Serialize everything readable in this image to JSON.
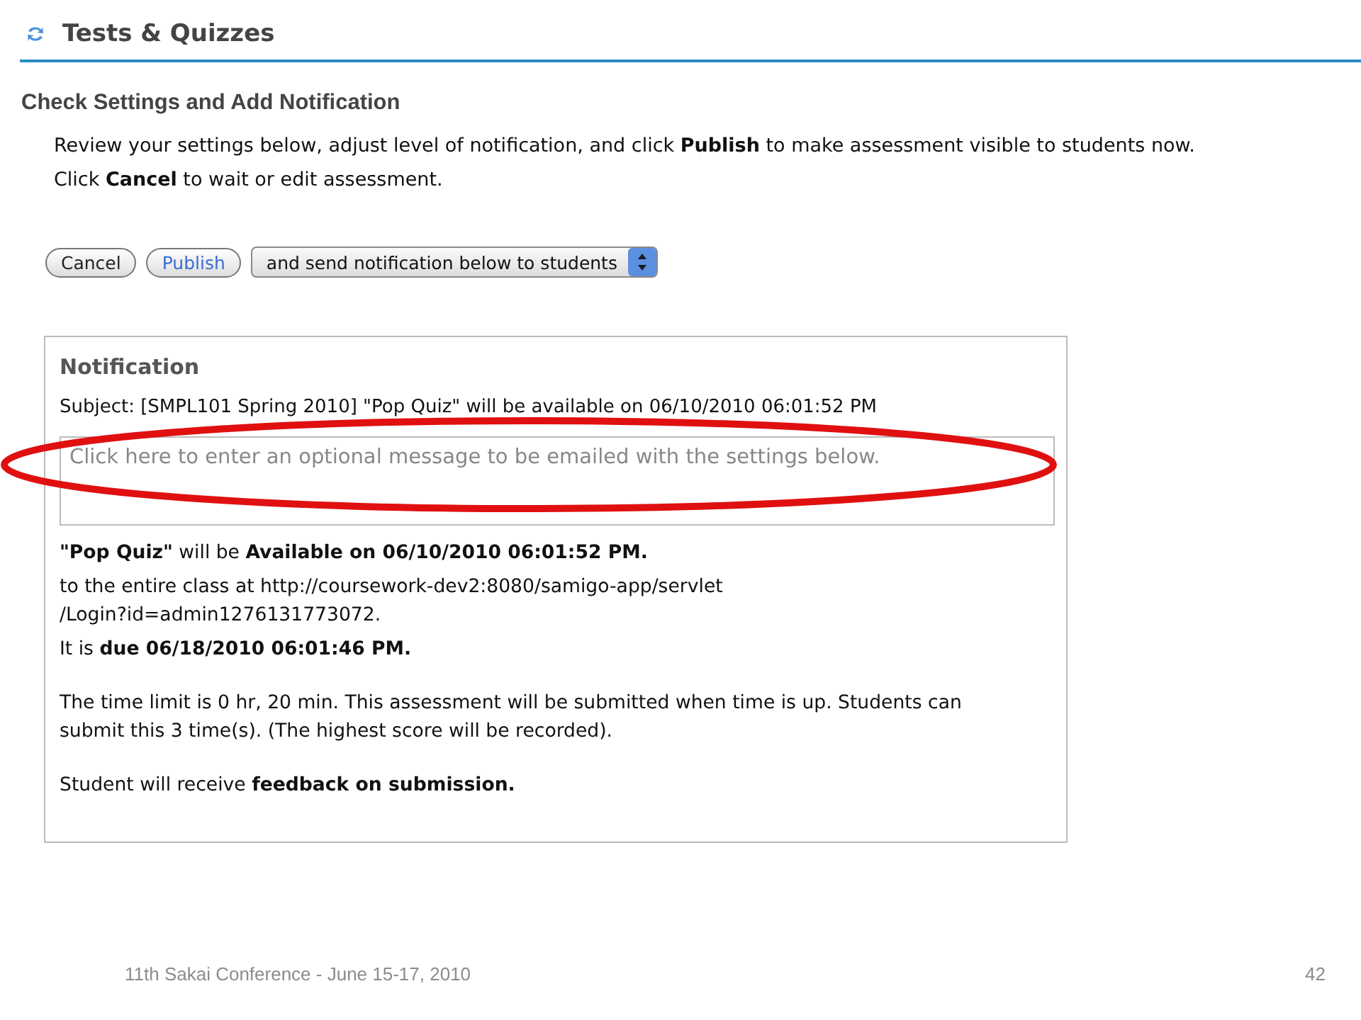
{
  "header": {
    "title": "Tests & Quizzes"
  },
  "heading": "Check Settings and Add Notification",
  "instructions": [
    "Review your settings below, adjust level of notification, and click **Publish** to make assessment visible to students now.",
    "Click **Cancel** to wait or edit assessment."
  ],
  "buttons": [
    {
      "label": "Cancel",
      "kind": "default"
    },
    {
      "label": "Publish",
      "kind": "primary"
    }
  ],
  "notify_select": {
    "value": "and send notification below to students"
  },
  "notification": {
    "title": "Notification",
    "subject": "Subject: [SMPL101 Spring 2010] \"Pop Quiz\" will be available on 06/10/2010 06:01:52 PM",
    "message": {
      "placeholder": "Click here to enter an optional message to be emailed with the settings below."
    },
    "sections": [
      {
        "lines": [
          "**\"Pop Quiz\"** will be **Available on 06/10/2010 06:01:52 PM.**",
          "to the entire class at http://coursework-dev2:8080/samigo-app/servlet\n/Login?id=admin1276131773072.",
          "It is **due 06/18/2010 06:01:46 PM.**"
        ]
      },
      {
        "lines": [
          "The time limit is 0 hr, 20 min. This assessment will be submitted when time is up. Students can\nsubmit this 3 time(s). (The highest score will be recorded)."
        ]
      },
      {
        "lines": [
          "Student will receive **feedback on submission.**"
        ]
      }
    ]
  },
  "annotation": {
    "kind": "ellipse"
  },
  "footer": {
    "conference": "11th Sakai Conference - June 15-17, 2010",
    "page": "42"
  }
}
